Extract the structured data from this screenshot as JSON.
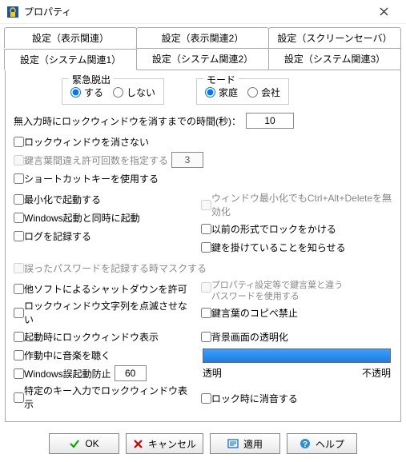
{
  "window": {
    "title": "プロパティ"
  },
  "tabs_row1": [
    {
      "label": "設定（表示関連）"
    },
    {
      "label": "設定（表示関連2）"
    },
    {
      "label": "設定（スクリーンセーバ）"
    }
  ],
  "tabs_row2": [
    {
      "label": "設定（システム関連1）",
      "active": true
    },
    {
      "label": "設定（システム関連2）"
    },
    {
      "label": "設定（システム関連3）"
    }
  ],
  "group_emergency": {
    "title": "緊急脱出",
    "options": [
      {
        "label": "する",
        "checked": true
      },
      {
        "label": "しない",
        "checked": false
      }
    ]
  },
  "group_mode": {
    "title": "モード",
    "options": [
      {
        "label": "家庭",
        "checked": true
      },
      {
        "label": "会社",
        "checked": false
      }
    ]
  },
  "timeout": {
    "label": "無入力時にロックウィンドウを消すまでの時間(秒)：",
    "value": "10"
  },
  "left": {
    "noclear": "ロックウィンドウを消さない",
    "mistake_limit": "鍵言葉間違え許可回数を指定する",
    "mistake_value": "3",
    "shortcut": "ショートカットキーを使用する",
    "start_min": "最小化で起動する",
    "autostart": "Windows起動と同時に起動",
    "log": "ログを記録する",
    "mask": "誤ったパスワードを記録する時マスクする",
    "allow_shutdown": "他ソフトによるシャットダウンを許可",
    "no_blink": "ロックウィンドウ文字列を点滅させない",
    "show_on_start": "起動時にロックウィンドウ表示",
    "music": "作動中に音楽を聴く",
    "misstart": "Windows誤起動防止",
    "misstart_value": "60",
    "specific_key": "特定のキー入力でロックウィンドウ表示"
  },
  "right": {
    "min_ctrl": "ウィンドウ最小化でもCtrl+Alt+Deleteを無効化",
    "old_lock": "以前の形式でロックをかける",
    "notify_lock": "鍵を掛けていることを知らせる",
    "use_prop_pwd_line1": "プロパティ設定等で鍵言葉と違う",
    "use_prop_pwd_line2": "パスワードを使用する",
    "no_copy_key": "鍵言葉のコピペ禁止",
    "bg_transparent": "背景画面の透明化",
    "slider_left": "透明",
    "slider_right": "不透明",
    "mute_on_lock": "ロック時に消音する"
  },
  "footer": {
    "ok": "OK",
    "cancel": "キャンセル",
    "apply": "適用",
    "help": "ヘルプ"
  }
}
